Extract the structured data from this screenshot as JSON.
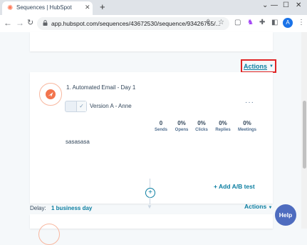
{
  "browser": {
    "tab_title": "Sequences | HubSpot",
    "tab_icon": "hubspot-sprocket-icon",
    "url": "app.hubspot.com/sequences/43672530/sequence/93426755/...",
    "avatar_letter": "A"
  },
  "sequence": {
    "top_actions_label": "Actions",
    "step": {
      "title": "1. Automated Email - Day 1",
      "version_label": "Version A - Anne",
      "stats": [
        {
          "value": "0",
          "label": "Sends"
        },
        {
          "value": "0%",
          "label": "Opens"
        },
        {
          "value": "0%",
          "label": "Clicks"
        },
        {
          "value": "0%",
          "label": "Replies"
        },
        {
          "value": "0%",
          "label": "Meetings"
        }
      ],
      "body_preview": "sasasasa",
      "add_ab_test_label": "+ Add A/B test"
    },
    "delay_label": "Delay:",
    "delay_value": "1 business day",
    "bottom_actions_label": "Actions"
  },
  "help_label": "Help",
  "colors": {
    "accent": "#0b7ea1",
    "highlight_border": "#e02424",
    "step_icon": "#f2754e",
    "help_button": "#4e6cbf"
  }
}
